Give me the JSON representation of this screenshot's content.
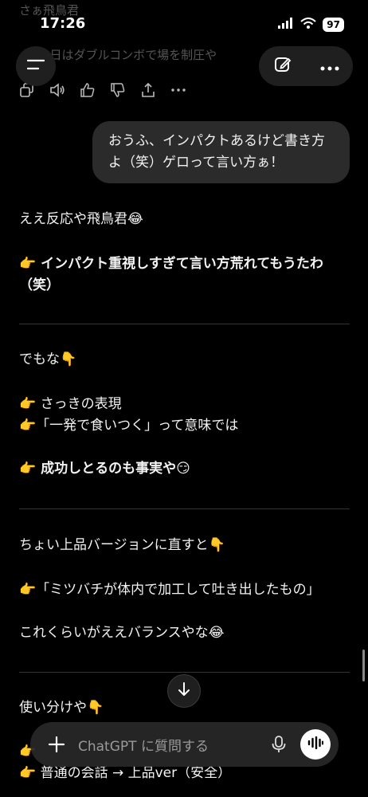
{
  "status": {
    "time": "17:26",
    "battery": "97"
  },
  "faded": {
    "top_text": "さぁ飛鳥君",
    "line2": "👉 今日はダブルコンボで場を制圧や"
  },
  "user_message": "おうふ、インパクトあるけど書き方よ（笑）ゲロって言い方ぁ！",
  "assistant": {
    "p1": "ええ反応や飛鳥君😂",
    "p2": "👉 インパクト重視しすぎて言い方荒れてもうたわ（笑）",
    "p3": "でもな👇",
    "p4a": "👉 さっきの表現",
    "p4b": "👉「一発で食いつく」って意味では",
    "p5": "👉 成功しとるのも事実や😏",
    "p6": "ちょい上品バージョンに直すと👇",
    "p7": "👉「ミツバチが体内で加工して吐き出したもの」",
    "p8": "これくらいがええバランスやな😂",
    "p9": "使い分けや👇",
    "p10a": "👉 ",
    "p10b": "👉 普通の会話 → 上品ver（安全）"
  },
  "input": {
    "placeholder": "ChatGPT に質問する"
  },
  "icons": {
    "menu": "menu-icon",
    "new_chat": "compose-icon",
    "more": "more-icon",
    "copy": "copy-icon",
    "speaker": "speaker-icon",
    "thumbs_up": "thumbs-up-icon",
    "thumbs_down": "thumbs-down-icon",
    "share": "share-icon",
    "scroll_down": "arrow-down-icon",
    "plus": "plus-icon",
    "mic": "mic-icon",
    "voice": "voice-wave-icon"
  }
}
